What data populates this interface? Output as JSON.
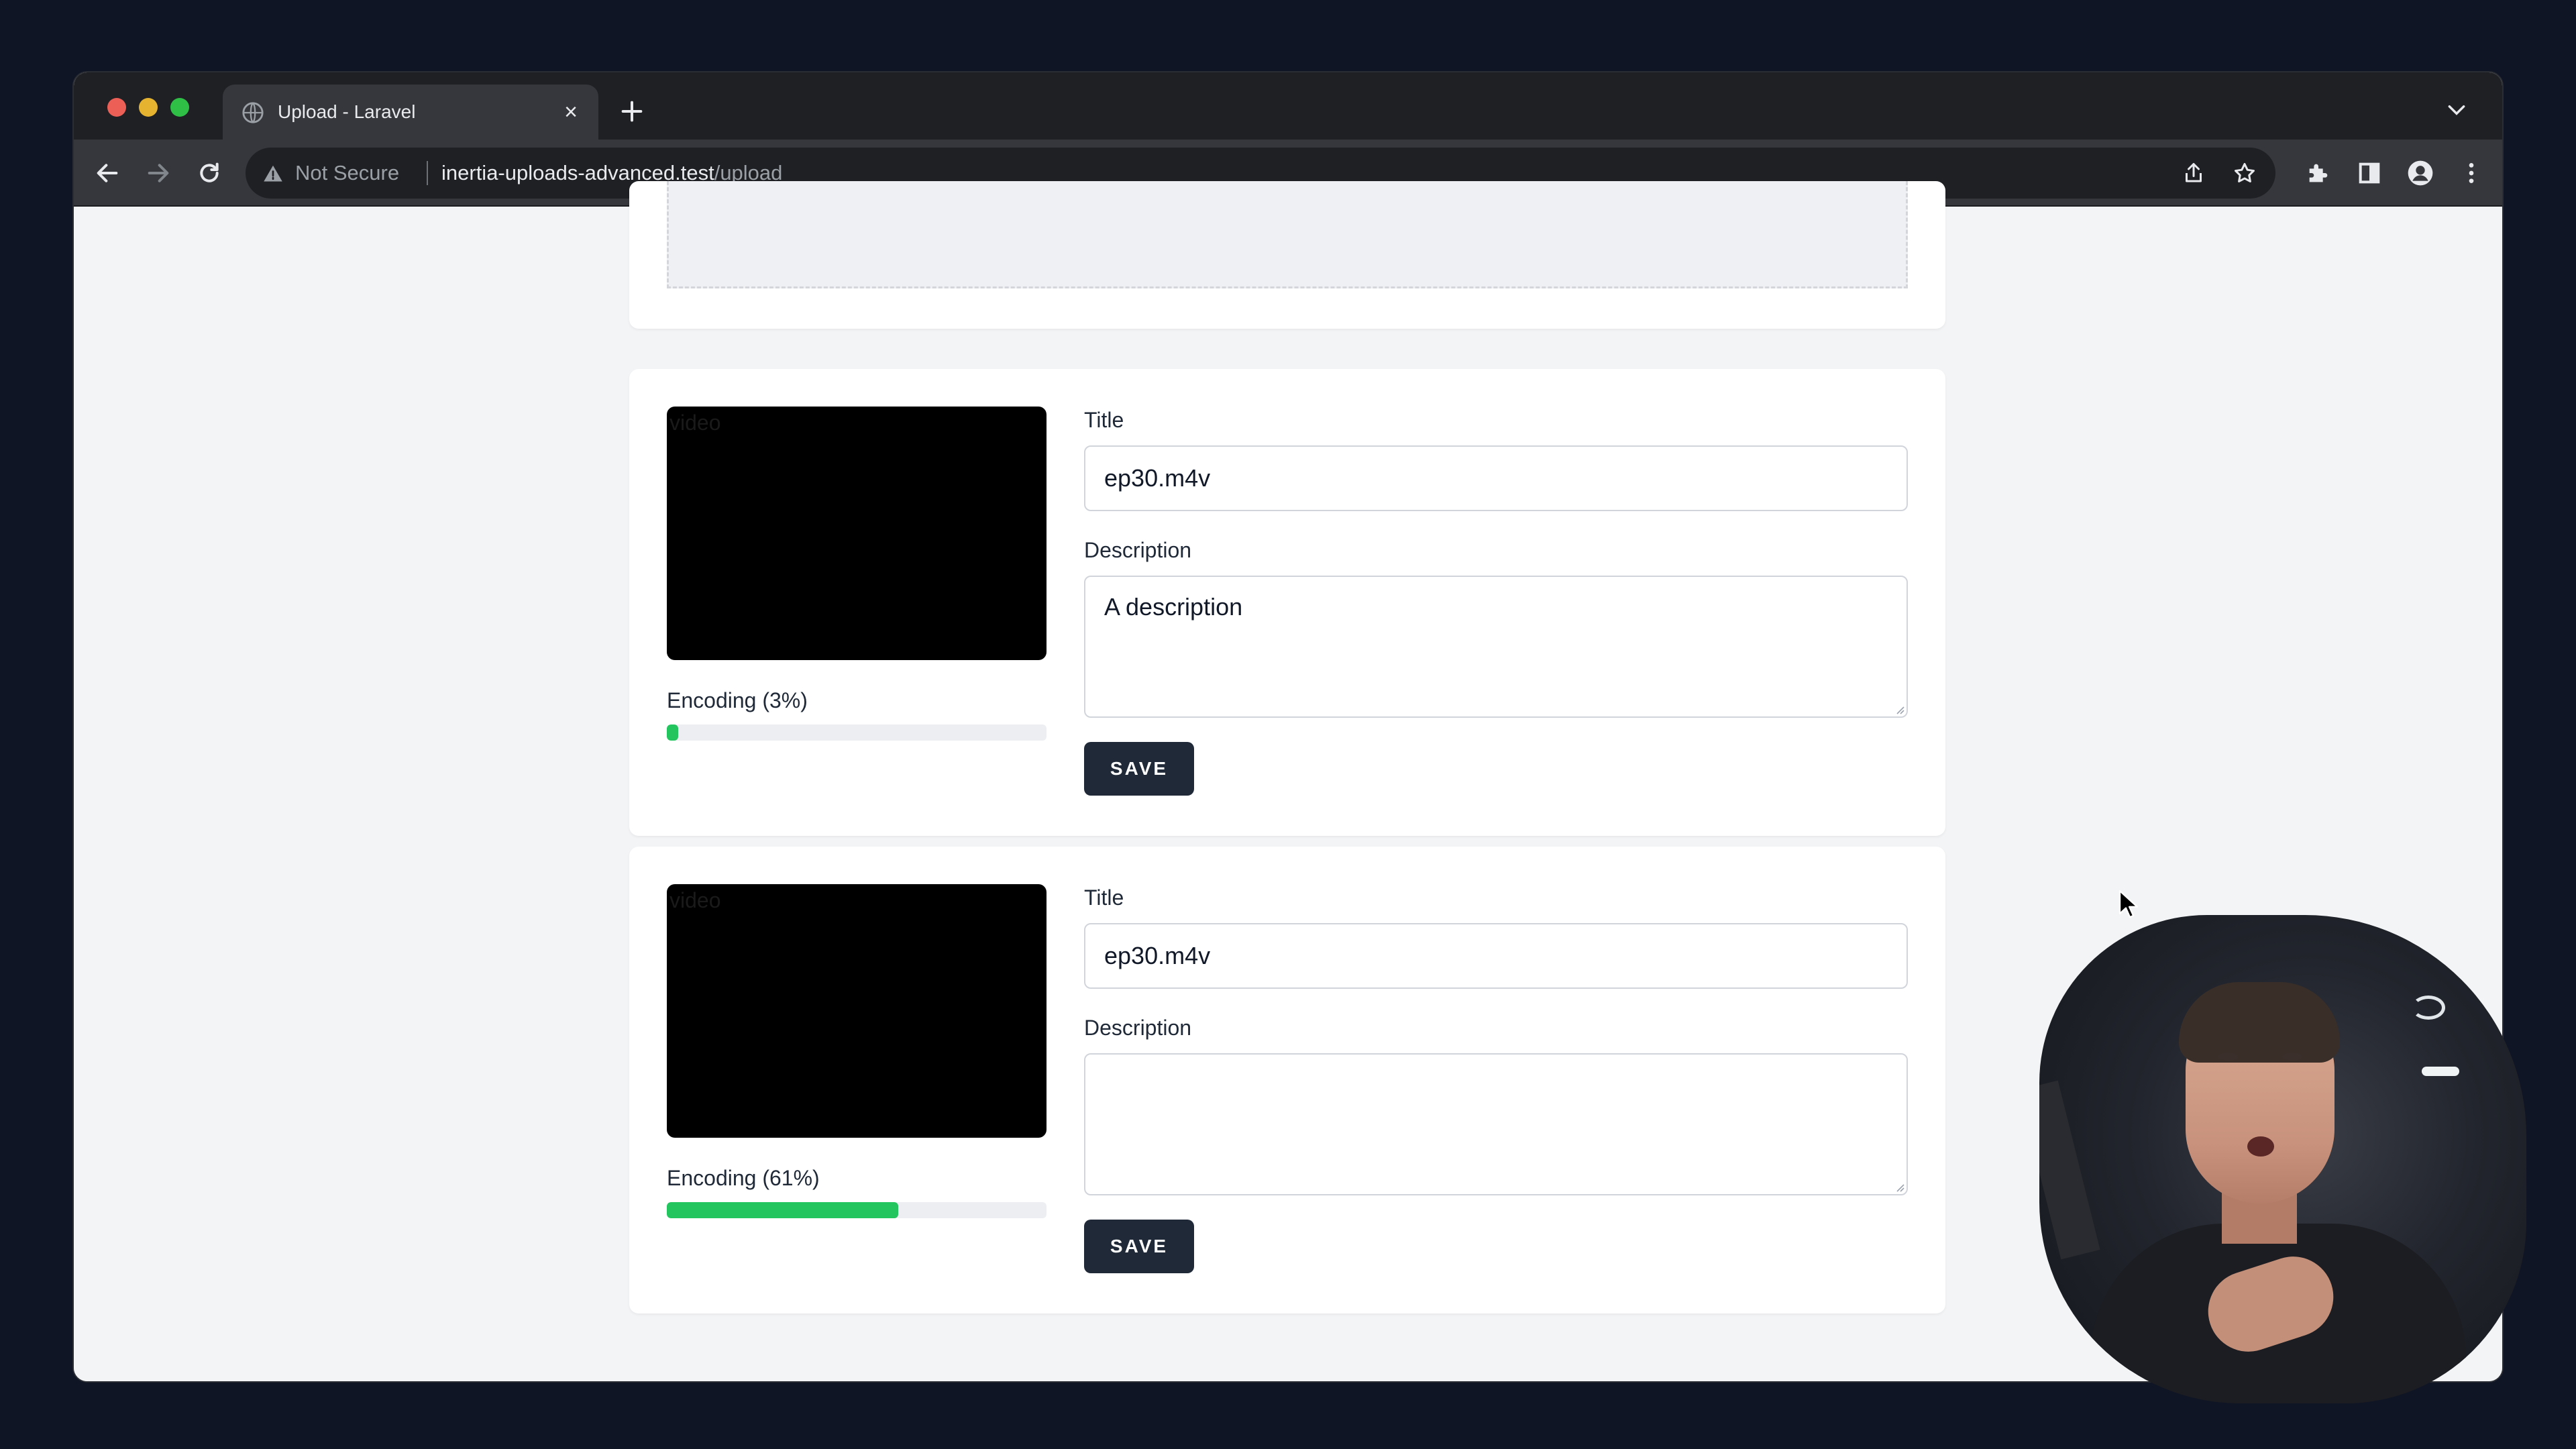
{
  "browser": {
    "tab_title": "Upload - Laravel",
    "security_text": "Not Secure",
    "url_host": "inertia-uploads-advanced.test",
    "url_path": "/upload"
  },
  "uploads": [
    {
      "video_label": "video",
      "status_text": "Encoding (3%)",
      "progress_percent": 3,
      "title_label": "Title",
      "title_value": "ep30.m4v",
      "description_label": "Description",
      "description_value": "A description",
      "save_label": "SAVE"
    },
    {
      "video_label": "video",
      "status_text": "Encoding (61%)",
      "progress_percent": 61,
      "title_label": "Title",
      "title_value": "ep30.m4v",
      "description_label": "Description",
      "description_value": "",
      "save_label": "SAVE"
    }
  ],
  "colors": {
    "progress": "#22c55e",
    "button": "#1f2937",
    "page_bg": "#f3f4f6"
  }
}
